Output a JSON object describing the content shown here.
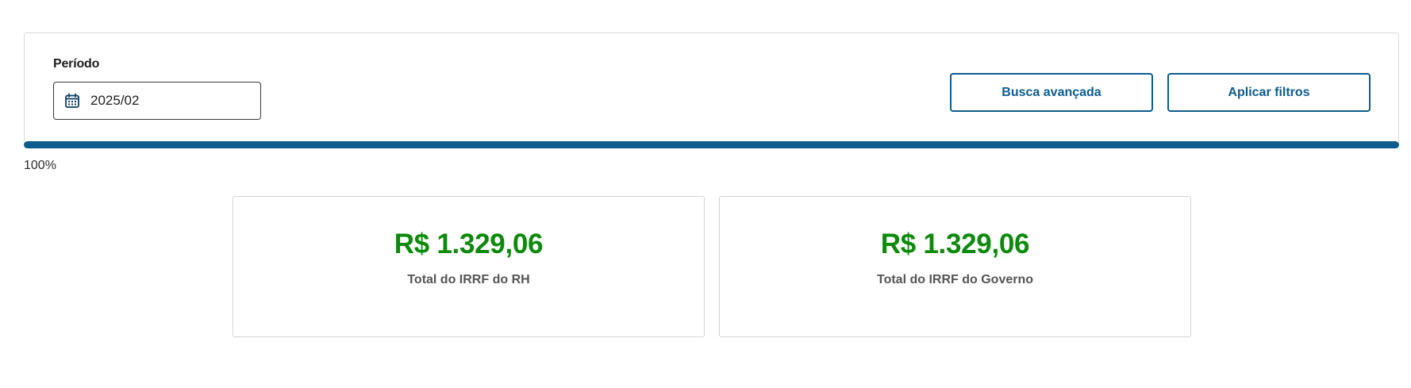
{
  "filters": {
    "period_label": "Período",
    "period_value": "2025/02",
    "period_icon": "calendar-icon",
    "advanced_search_label": "Busca avançada",
    "apply_filters_label": "Aplicar filtros"
  },
  "progress": {
    "percent": 100,
    "text": "100%"
  },
  "cards": [
    {
      "value": "R$ 1.329,06",
      "label": "Total do IRRF do RH"
    },
    {
      "value": "R$ 1.329,06",
      "label": "Total do IRRF do Governo"
    }
  ],
  "colors": {
    "primary": "#0c5c8e",
    "value_green": "#0b8a0b",
    "border": "#d4d4d4"
  }
}
